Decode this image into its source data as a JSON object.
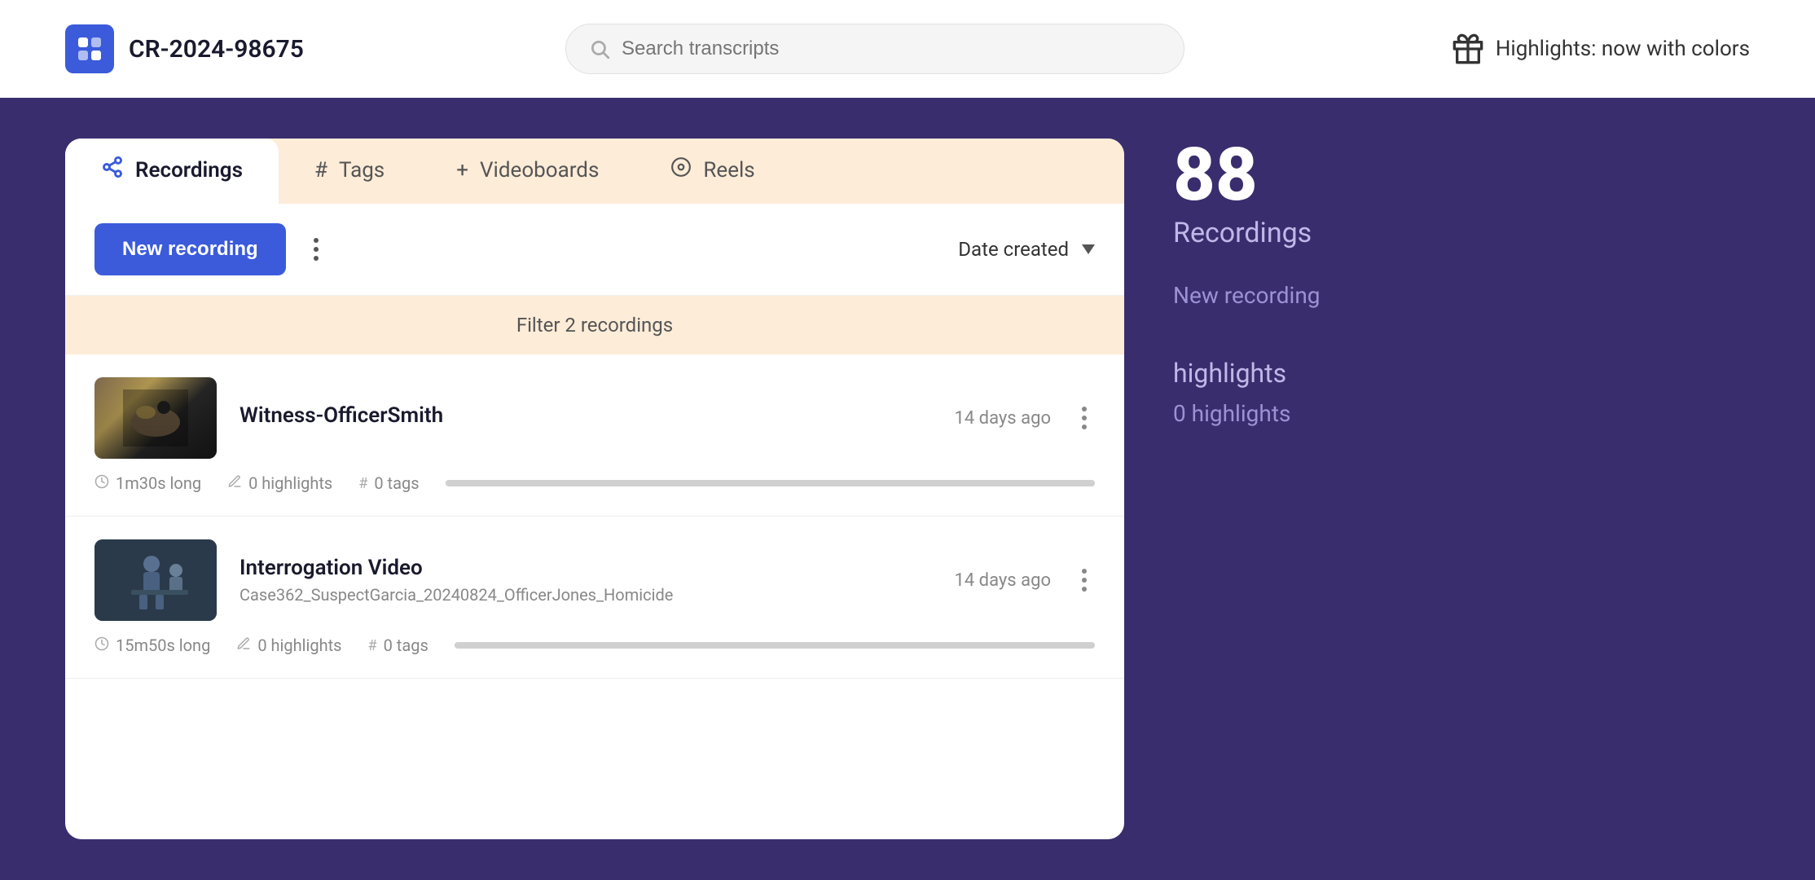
{
  "topbar": {
    "project_name": "CR-2024-98675",
    "search_placeholder": "Search transcripts",
    "highlights_banner": "Highlights: now with colors"
  },
  "tabs": [
    {
      "id": "recordings",
      "label": "Recordings",
      "icon": "recordings-icon",
      "active": true
    },
    {
      "id": "tags",
      "label": "Tags",
      "icon": "hash-icon",
      "active": false
    },
    {
      "id": "videoboards",
      "label": "Videoboards",
      "icon": "plus-icon",
      "active": false
    },
    {
      "id": "reels",
      "label": "Reels",
      "icon": "reels-icon",
      "active": false
    }
  ],
  "toolbar": {
    "new_recording_label": "New recording",
    "sort_label": "Date created"
  },
  "filter_bar": {
    "text": "Filter 2 recordings"
  },
  "recordings": [
    {
      "id": "r1",
      "title": "Witness-OfficerSmith",
      "subtitle": "",
      "time_ago": "14 days ago",
      "duration": "1m30s long",
      "highlights": "0 highlights",
      "tags": "0 tags",
      "thumb_type": "food"
    },
    {
      "id": "r2",
      "title": "Interrogation Video",
      "subtitle": "Case362_SuspectGarcia_20240824_OfficerJones_Homicide",
      "time_ago": "14 days ago",
      "duration": "15m50s long",
      "highlights": "0 highlights",
      "tags": "0 tags",
      "thumb_type": "interrogation"
    }
  ],
  "sidebar_stats": {
    "count": "88",
    "count_label": "Recordings",
    "new_recording_hint": "New recording",
    "highlights_section_title": "highlights",
    "highlights_count": "0 highlights"
  }
}
